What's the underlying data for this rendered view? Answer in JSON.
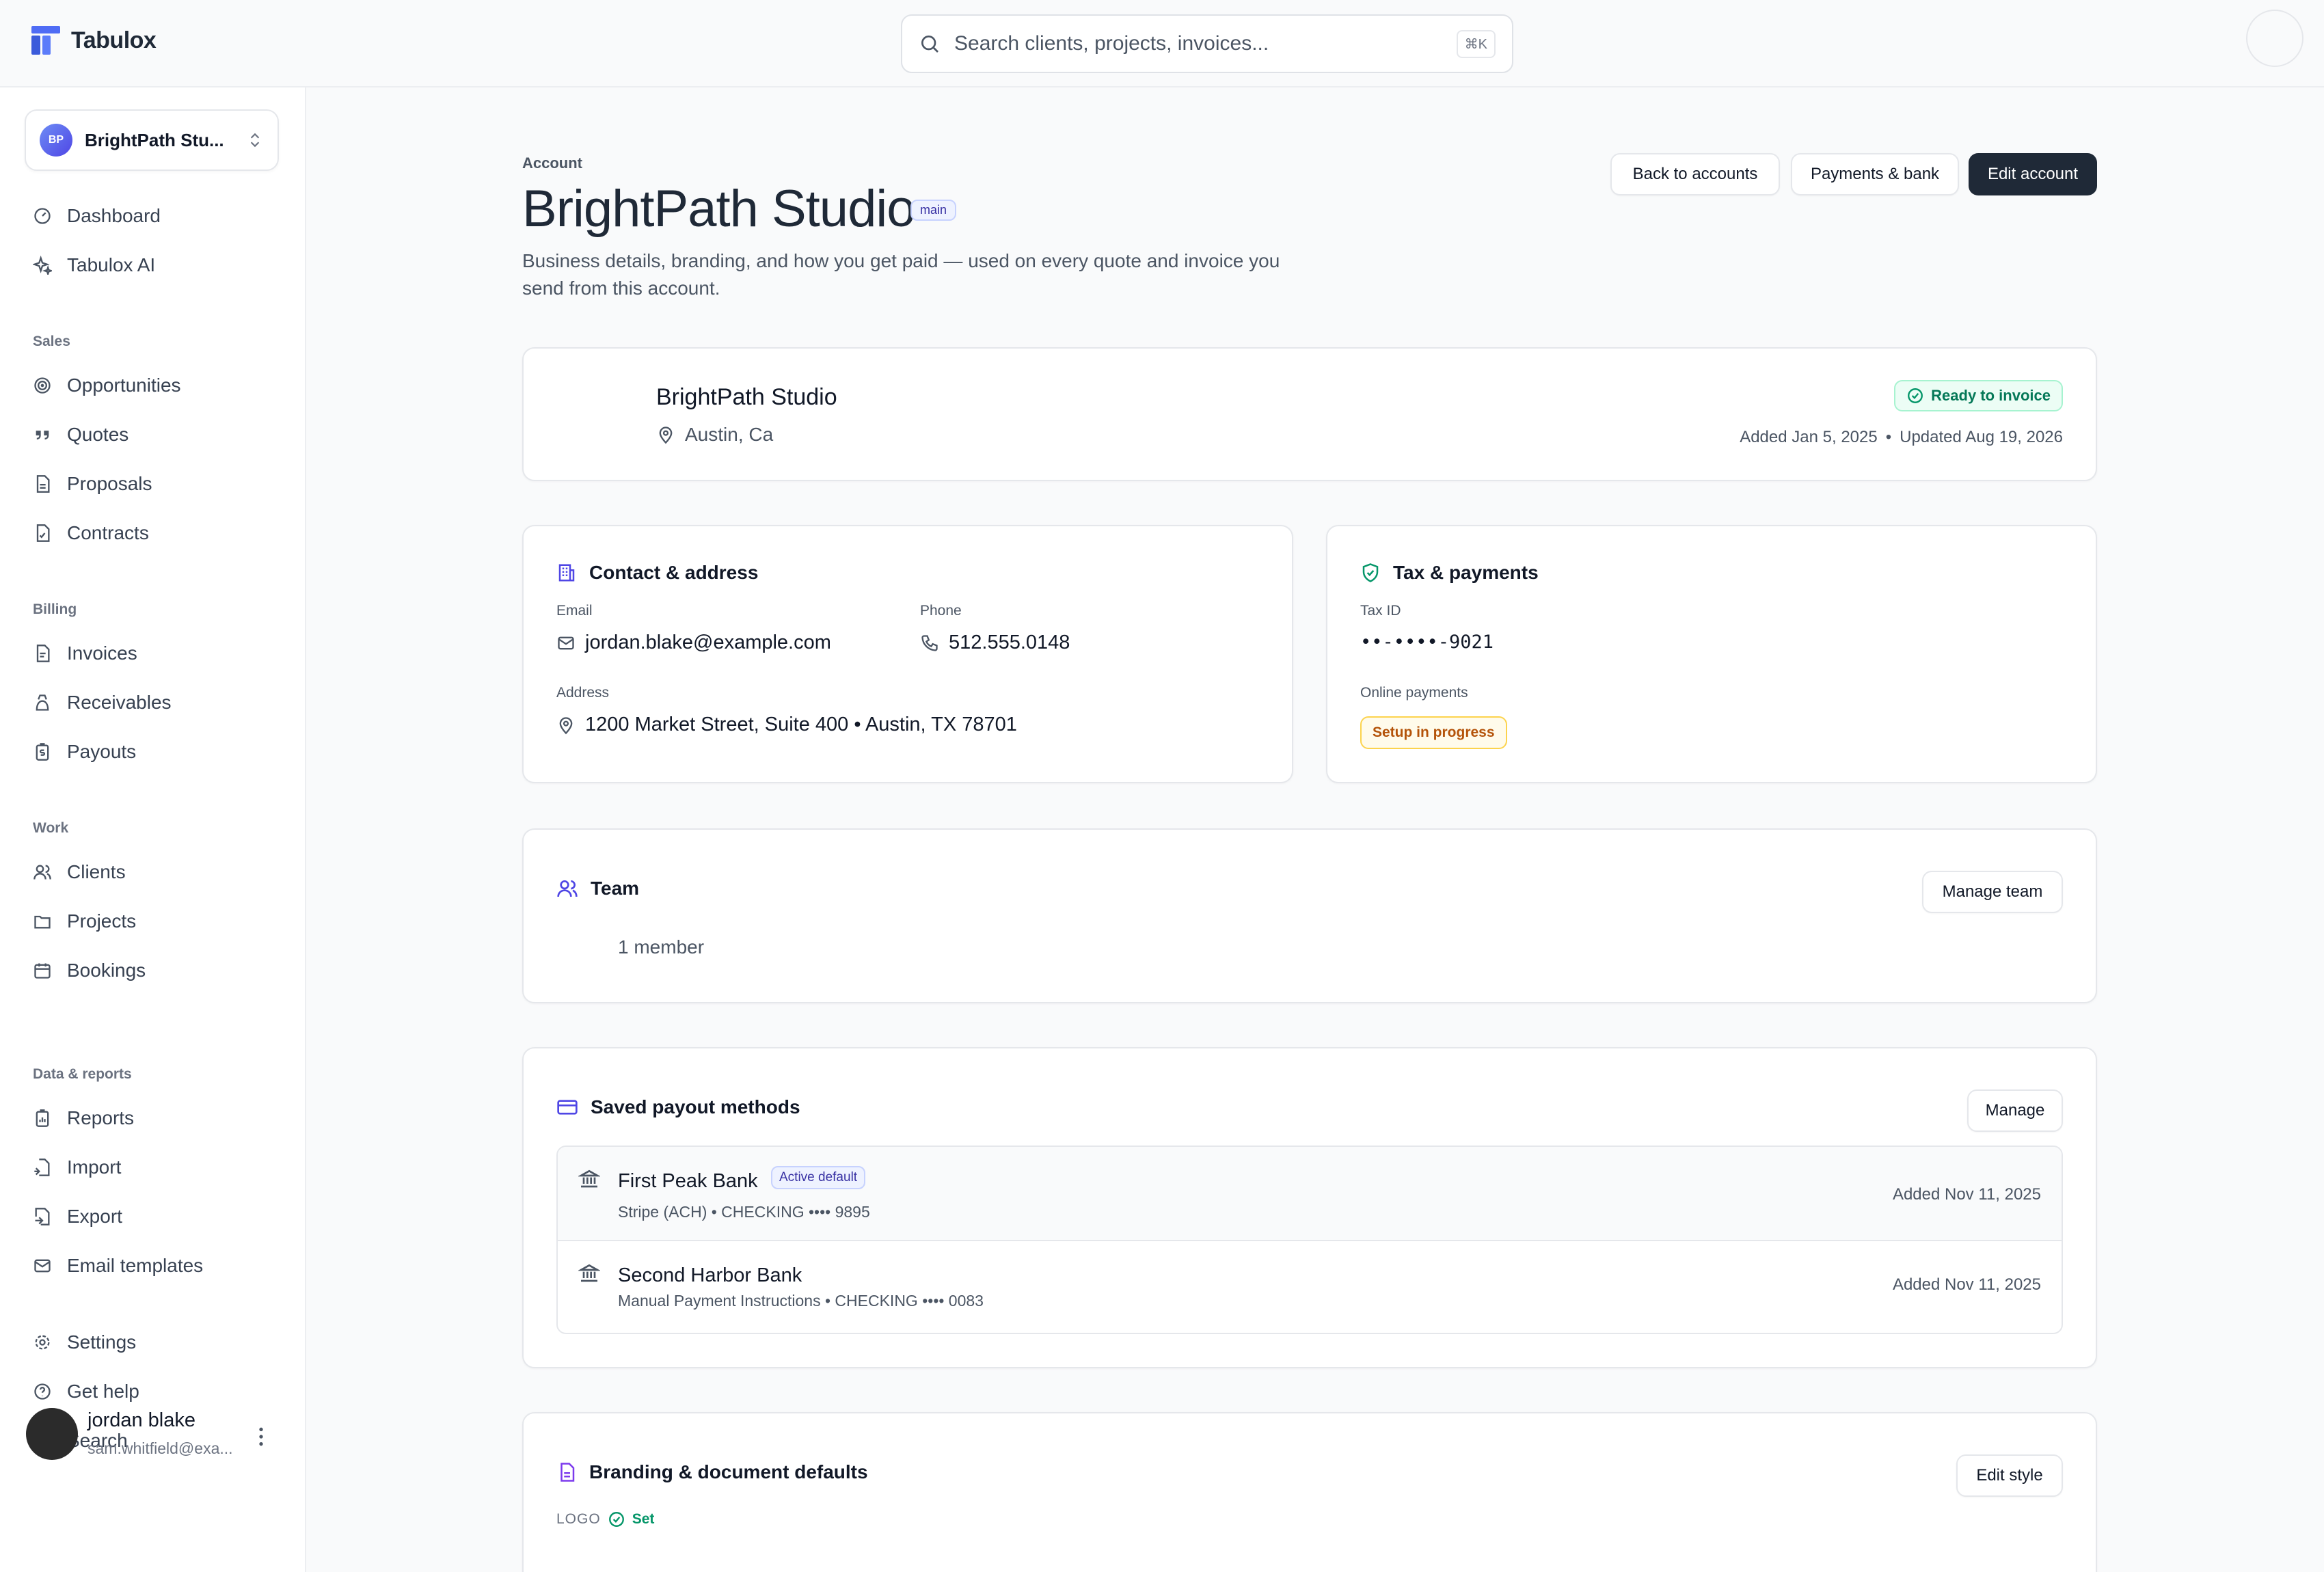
{
  "app": {
    "name": "Tabulox"
  },
  "search": {
    "placeholder": "Search clients, projects, invoices...",
    "shortcut": "⌘K"
  },
  "workspace": {
    "initials": "BP",
    "name": "BrightPath Stu..."
  },
  "sidebar": {
    "top": [
      {
        "label": "Dashboard",
        "icon": "dashboard-icon"
      },
      {
        "label": "Tabulox AI",
        "icon": "sparkles-icon"
      }
    ],
    "groups": [
      {
        "title": "Sales",
        "items": [
          {
            "label": "Opportunities",
            "icon": "target-icon"
          },
          {
            "label": "Quotes",
            "icon": "quote-icon"
          },
          {
            "label": "Proposals",
            "icon": "document-icon"
          },
          {
            "label": "Contracts",
            "icon": "contract-icon"
          }
        ]
      },
      {
        "title": "Billing",
        "items": [
          {
            "label": "Invoices",
            "icon": "invoice-icon"
          },
          {
            "label": "Receivables",
            "icon": "receivables-icon"
          },
          {
            "label": "Payouts",
            "icon": "payouts-icon"
          }
        ]
      },
      {
        "title": "Work",
        "items": [
          {
            "label": "Clients",
            "icon": "users-icon"
          },
          {
            "label": "Projects",
            "icon": "folder-icon"
          },
          {
            "label": "Bookings",
            "icon": "calendar-icon"
          }
        ]
      },
      {
        "title": "Data & reports",
        "items": [
          {
            "label": "Reports",
            "icon": "reports-icon"
          },
          {
            "label": "Import",
            "icon": "import-icon"
          },
          {
            "label": "Export",
            "icon": "export-icon"
          },
          {
            "label": "Email templates",
            "icon": "mail-icon"
          }
        ]
      }
    ],
    "bottom": [
      {
        "label": "Settings",
        "icon": "gear-icon"
      },
      {
        "label": "Get help",
        "icon": "help-icon"
      },
      {
        "label": "Search",
        "icon": "search-icon"
      }
    ],
    "user": {
      "name": "jordan blake",
      "email": "sam.whitfield@exa..."
    }
  },
  "page": {
    "eyebrow": "Account",
    "title": "BrightPath Studio",
    "tag": "main",
    "subtitle": "Business details, branding, and how you get paid — used on every quote and invoice you send from this account.",
    "actions": {
      "back": "Back to accounts",
      "payments": "Payments & bank",
      "edit": "Edit account"
    }
  },
  "summary": {
    "name": "BrightPath Studio",
    "location": "Austin, Ca",
    "status": "Ready to invoice",
    "added": "Added Jan 5, 2025",
    "separator": "•",
    "updated": "Updated Aug 19, 2026"
  },
  "contact": {
    "title": "Contact & address",
    "email_label": "Email",
    "email": "jordan.blake@example.com",
    "phone_label": "Phone",
    "phone": "512.555.0148",
    "address_label": "Address",
    "address": "1200 Market Street, Suite 400 • Austin, TX 78701"
  },
  "tax": {
    "title": "Tax & payments",
    "tax_id_label": "Tax ID",
    "tax_id": "••-••••-9021",
    "online_label": "Online payments",
    "online_status": "Setup in progress"
  },
  "team": {
    "title": "Team",
    "button": "Manage team",
    "members": "1 member"
  },
  "payouts": {
    "title": "Saved payout methods",
    "button": "Manage",
    "methods": [
      {
        "bank": "First Peak Bank",
        "badge": "Active default",
        "detail": "Stripe (ACH) • CHECKING •••• 9895",
        "added": "Added Nov 11, 2025"
      },
      {
        "bank": "Second Harbor Bank",
        "detail": "Manual Payment Instructions • CHECKING •••• 0083",
        "added": "Added Nov 11, 2025"
      }
    ]
  },
  "branding": {
    "title": "Branding & document defaults",
    "button": "Edit style",
    "logo_label": "LOGO",
    "logo_status": "Set"
  },
  "colors": {
    "accent": "#4f46e5",
    "success": "#059669",
    "warning": "#b45309",
    "dark": "#1f2937"
  }
}
